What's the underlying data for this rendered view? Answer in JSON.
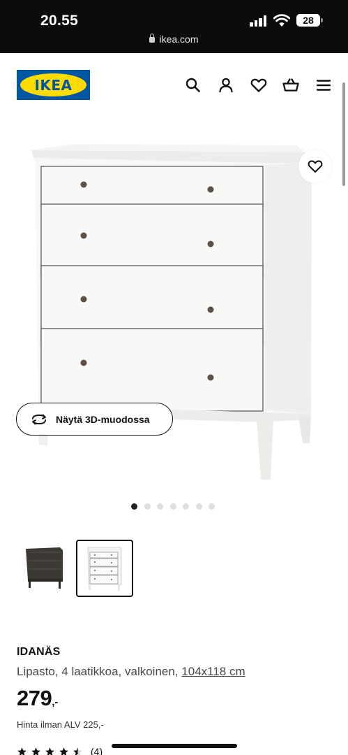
{
  "status_bar": {
    "time": "20.55",
    "battery": "28",
    "url": "ikea.com"
  },
  "header": {
    "logo_text": "IKEA",
    "icons": [
      "search-icon",
      "user-icon",
      "heart-icon",
      "basket-icon",
      "menu-icon"
    ]
  },
  "gallery": {
    "view_3d_label": "Näytä 3D-muodossa",
    "dot_count": 7,
    "active_dot": 0,
    "thumbnails": [
      "dark-brown-dresser",
      "white-dresser"
    ],
    "selected_thumbnail": 1
  },
  "product": {
    "name": "IDANÄS",
    "description": "Lipasto, 4 laatikkoa, valkoinen,",
    "size_link": "104x118 cm",
    "price": "279",
    "price_suffix": ",-",
    "vat_text": "Hinta ilman ALV 225,-",
    "rating": 4.5,
    "review_count": "(4)"
  },
  "colors": {
    "brand_blue": "#0058a3",
    "brand_yellow": "#ffdb00"
  }
}
